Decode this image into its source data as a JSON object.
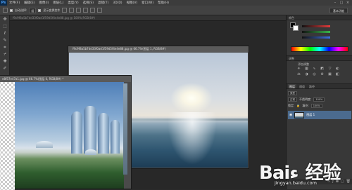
{
  "app": {
    "logo": "Ps"
  },
  "menu": [
    "文件(F)",
    "编辑(E)",
    "图像(I)",
    "图层(L)",
    "类型(Y)",
    "选择(S)",
    "滤镜(T)",
    "3D(D)",
    "视图(V)",
    "窗口(W)",
    "帮助(H)"
  ],
  "options": {
    "auto_select_label": "自动选择:",
    "auto_select_value": "组",
    "transform_label": "显示变换控件"
  },
  "workspace": {
    "essentials": "基本功能"
  },
  "doc_tab": {
    "title": "f9c9f8a5b7dd33f0ad1f59d5f4e4e88.jpg @ 100%(RGB/8#)"
  },
  "sea_window": {
    "title": "f9c9f8a5b7dd33f0ad1f59d5f4e4e88.jpg @ 66.7%(图层 1, RGB/8#)"
  },
  "city_window": {
    "title": "e8f57e47a1.jpg @ 66.7%(图层 0, RGB/8#) *"
  },
  "panels": {
    "color_tab": "颜色",
    "adjust_tab": "调整",
    "adjust_title": "添加调整",
    "layers_tabs": [
      "图层",
      "通道",
      "路径"
    ],
    "kind_label": "类型",
    "blend_mode": "正常",
    "opacity_label": "不透明度:",
    "opacity_value": "100%",
    "lock_label": "锁定:",
    "fill_label": "填充:",
    "fill_value": "100%",
    "layer_name": "图层 1"
  },
  "watermark": {
    "text": "Baiء 经验",
    "sub": "jingyan.baidu.com"
  },
  "colors": {
    "slider_r": "#e23b3b",
    "slider_g": "#39b54a",
    "slider_b": "#3b6fe2"
  }
}
